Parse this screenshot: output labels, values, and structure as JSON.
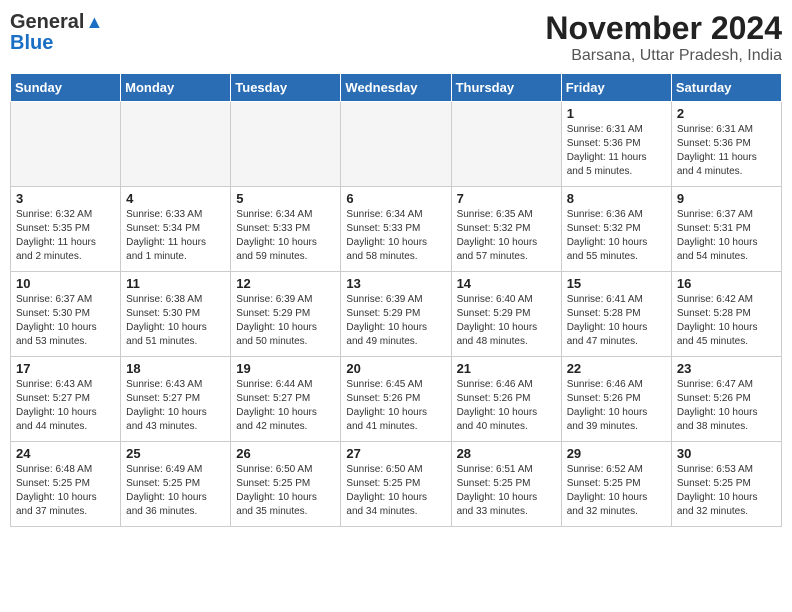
{
  "header": {
    "logo_line1": "General",
    "logo_line2": "Blue",
    "title": "November 2024",
    "subtitle": "Barsana, Uttar Pradesh, India"
  },
  "days_of_week": [
    "Sunday",
    "Monday",
    "Tuesday",
    "Wednesday",
    "Thursday",
    "Friday",
    "Saturday"
  ],
  "weeks": [
    [
      {
        "day": "",
        "info": ""
      },
      {
        "day": "",
        "info": ""
      },
      {
        "day": "",
        "info": ""
      },
      {
        "day": "",
        "info": ""
      },
      {
        "day": "",
        "info": ""
      },
      {
        "day": "1",
        "info": "Sunrise: 6:31 AM\nSunset: 5:36 PM\nDaylight: 11 hours\nand 5 minutes."
      },
      {
        "day": "2",
        "info": "Sunrise: 6:31 AM\nSunset: 5:36 PM\nDaylight: 11 hours\nand 4 minutes."
      }
    ],
    [
      {
        "day": "3",
        "info": "Sunrise: 6:32 AM\nSunset: 5:35 PM\nDaylight: 11 hours\nand 2 minutes."
      },
      {
        "day": "4",
        "info": "Sunrise: 6:33 AM\nSunset: 5:34 PM\nDaylight: 11 hours\nand 1 minute."
      },
      {
        "day": "5",
        "info": "Sunrise: 6:34 AM\nSunset: 5:33 PM\nDaylight: 10 hours\nand 59 minutes."
      },
      {
        "day": "6",
        "info": "Sunrise: 6:34 AM\nSunset: 5:33 PM\nDaylight: 10 hours\nand 58 minutes."
      },
      {
        "day": "7",
        "info": "Sunrise: 6:35 AM\nSunset: 5:32 PM\nDaylight: 10 hours\nand 57 minutes."
      },
      {
        "day": "8",
        "info": "Sunrise: 6:36 AM\nSunset: 5:32 PM\nDaylight: 10 hours\nand 55 minutes."
      },
      {
        "day": "9",
        "info": "Sunrise: 6:37 AM\nSunset: 5:31 PM\nDaylight: 10 hours\nand 54 minutes."
      }
    ],
    [
      {
        "day": "10",
        "info": "Sunrise: 6:37 AM\nSunset: 5:30 PM\nDaylight: 10 hours\nand 53 minutes."
      },
      {
        "day": "11",
        "info": "Sunrise: 6:38 AM\nSunset: 5:30 PM\nDaylight: 10 hours\nand 51 minutes."
      },
      {
        "day": "12",
        "info": "Sunrise: 6:39 AM\nSunset: 5:29 PM\nDaylight: 10 hours\nand 50 minutes."
      },
      {
        "day": "13",
        "info": "Sunrise: 6:39 AM\nSunset: 5:29 PM\nDaylight: 10 hours\nand 49 minutes."
      },
      {
        "day": "14",
        "info": "Sunrise: 6:40 AM\nSunset: 5:29 PM\nDaylight: 10 hours\nand 48 minutes."
      },
      {
        "day": "15",
        "info": "Sunrise: 6:41 AM\nSunset: 5:28 PM\nDaylight: 10 hours\nand 47 minutes."
      },
      {
        "day": "16",
        "info": "Sunrise: 6:42 AM\nSunset: 5:28 PM\nDaylight: 10 hours\nand 45 minutes."
      }
    ],
    [
      {
        "day": "17",
        "info": "Sunrise: 6:43 AM\nSunset: 5:27 PM\nDaylight: 10 hours\nand 44 minutes."
      },
      {
        "day": "18",
        "info": "Sunrise: 6:43 AM\nSunset: 5:27 PM\nDaylight: 10 hours\nand 43 minutes."
      },
      {
        "day": "19",
        "info": "Sunrise: 6:44 AM\nSunset: 5:27 PM\nDaylight: 10 hours\nand 42 minutes."
      },
      {
        "day": "20",
        "info": "Sunrise: 6:45 AM\nSunset: 5:26 PM\nDaylight: 10 hours\nand 41 minutes."
      },
      {
        "day": "21",
        "info": "Sunrise: 6:46 AM\nSunset: 5:26 PM\nDaylight: 10 hours\nand 40 minutes."
      },
      {
        "day": "22",
        "info": "Sunrise: 6:46 AM\nSunset: 5:26 PM\nDaylight: 10 hours\nand 39 minutes."
      },
      {
        "day": "23",
        "info": "Sunrise: 6:47 AM\nSunset: 5:26 PM\nDaylight: 10 hours\nand 38 minutes."
      }
    ],
    [
      {
        "day": "24",
        "info": "Sunrise: 6:48 AM\nSunset: 5:25 PM\nDaylight: 10 hours\nand 37 minutes."
      },
      {
        "day": "25",
        "info": "Sunrise: 6:49 AM\nSunset: 5:25 PM\nDaylight: 10 hours\nand 36 minutes."
      },
      {
        "day": "26",
        "info": "Sunrise: 6:50 AM\nSunset: 5:25 PM\nDaylight: 10 hours\nand 35 minutes."
      },
      {
        "day": "27",
        "info": "Sunrise: 6:50 AM\nSunset: 5:25 PM\nDaylight: 10 hours\nand 34 minutes."
      },
      {
        "day": "28",
        "info": "Sunrise: 6:51 AM\nSunset: 5:25 PM\nDaylight: 10 hours\nand 33 minutes."
      },
      {
        "day": "29",
        "info": "Sunrise: 6:52 AM\nSunset: 5:25 PM\nDaylight: 10 hours\nand 32 minutes."
      },
      {
        "day": "30",
        "info": "Sunrise: 6:53 AM\nSunset: 5:25 PM\nDaylight: 10 hours\nand 32 minutes."
      }
    ]
  ]
}
